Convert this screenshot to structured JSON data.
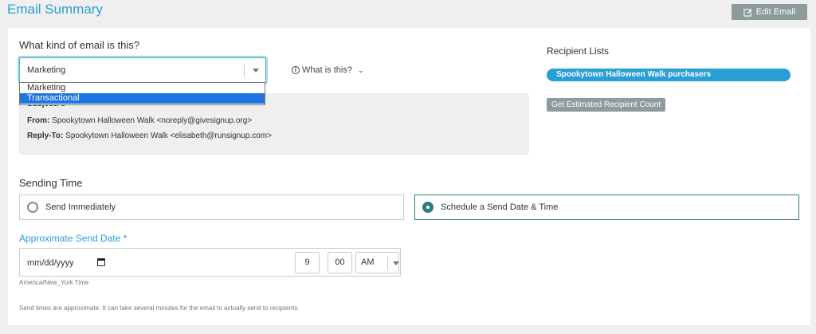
{
  "header": {
    "title": "Email Summary",
    "edit_label": "Edit Email"
  },
  "email_type": {
    "question": "What kind of email is this?",
    "selected": "Marketing",
    "options": [
      "Marketing",
      "Transactional"
    ],
    "highlighted_option": "Transactional",
    "help_label": "What is this?"
  },
  "preview": {
    "subject_label": "Subject:",
    "subject_value": "d",
    "from_label": "From:",
    "from_value": "Spookytown Halloween Walk <noreply@givesignup.org>",
    "replyto_label": "Reply-To:",
    "replyto_value": "Spookytown Halloween Walk <elisabeth@runsignup.com>"
  },
  "recipients": {
    "title": "Recipient Lists",
    "lists": [
      "Spookytown Halloween Walk purchasers"
    ],
    "count_button": "Get Estimated Recipient Count"
  },
  "sending_time": {
    "title": "Sending Time",
    "option_immediate": "Send Immediately",
    "option_schedule": "Schedule a Send Date & Time",
    "selected": "schedule",
    "date_label": "Approximate Send Date *",
    "date_placeholder": "mm/dd/yyyy",
    "hour": "9",
    "minute": "00",
    "ampm": "AM",
    "timezone": "America/New_York Time",
    "note": "Send times are approximate. It can take several minutes for the email to actually send to recipients."
  },
  "colors": {
    "accent": "#2a9fd6",
    "selected_radio": "#2e7d7d",
    "button_gray": "#8f9a9d"
  }
}
